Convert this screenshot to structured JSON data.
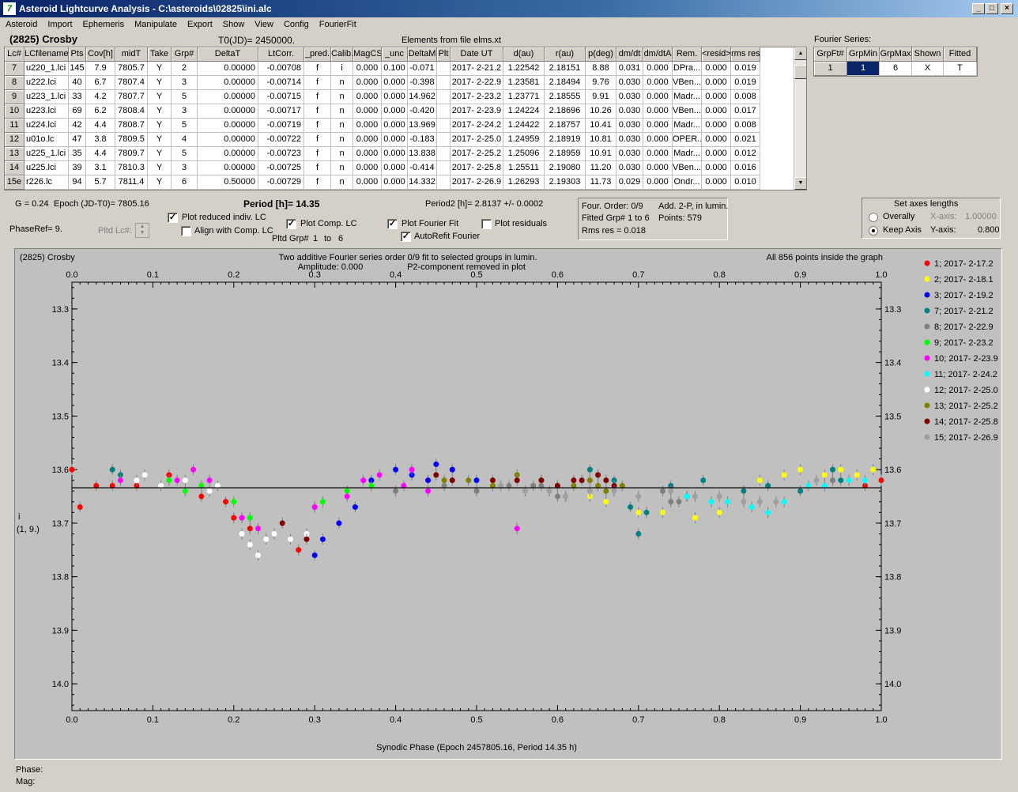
{
  "window": {
    "title": "Asteroid Lightcurve Analysis - C:\\asteroids\\02825\\ini.alc",
    "icon": "app-icon"
  },
  "menu": [
    "Asteroid",
    "Import",
    "Ephemeris",
    "Manipulate",
    "Export",
    "Show",
    "View",
    "Config",
    "FourierFit"
  ],
  "info": {
    "asteroid": "(2825) Crosby",
    "t0": "T0(JD)= 2450000.",
    "elements": "Elements from file elms.xt"
  },
  "table": {
    "headers": [
      "Lc#",
      "LCfilename",
      "Pts",
      "Cov[h]",
      "midT",
      "Take",
      "Grp#",
      "DeltaT",
      "LtCorr.",
      "_pred.",
      "Calib.",
      "MagCS",
      "_unc",
      "DeltaM",
      "Plt",
      "Date UT",
      "d(au)",
      "r(au)",
      "p(deg)",
      "dm/dt",
      "dm/dtA",
      "Rem.",
      "<resid>",
      "rms res"
    ],
    "rows": [
      [
        "7",
        "u220_1.lci",
        "145",
        "7.9",
        "7805.7",
        "Y",
        "2",
        "0.00000",
        "-0.00708",
        "f",
        "i",
        "0.000",
        "0.100",
        "-0.071",
        "",
        "2017- 2-21.2",
        "1.22542",
        "2.18151",
        "8.88",
        "0.031",
        "0.000",
        "DPra...",
        "0.000",
        "0.019"
      ],
      [
        "8",
        "u222.lci",
        "40",
        "6.7",
        "7807.4",
        "Y",
        "3",
        "0.00000",
        "-0.00714",
        "f",
        "n",
        "0.000",
        "0.000",
        "-0.398",
        "",
        "2017- 2-22.9",
        "1.23581",
        "2.18494",
        "9.76",
        "0.030",
        "0.000",
        "VBen...",
        "0.000",
        "0.019"
      ],
      [
        "9",
        "u223_1.lci",
        "33",
        "4.2",
        "7807.7",
        "Y",
        "5",
        "0.00000",
        "-0.00715",
        "f",
        "n",
        "0.000",
        "0.000",
        "14.962",
        "",
        "2017- 2-23.2",
        "1.23771",
        "2.18555",
        "9.91",
        "0.030",
        "0.000",
        "Madr...",
        "0.000",
        "0.008"
      ],
      [
        "10",
        "u223.lci",
        "69",
        "6.2",
        "7808.4",
        "Y",
        "3",
        "0.00000",
        "-0.00717",
        "f",
        "n",
        "0.000",
        "0.000",
        "-0.420",
        "",
        "2017- 2-23.9",
        "1.24224",
        "2.18696",
        "10.26",
        "0.030",
        "0.000",
        "VBen...",
        "0.000",
        "0.017"
      ],
      [
        "11",
        "u224.lci",
        "42",
        "4.4",
        "7808.7",
        "Y",
        "5",
        "0.00000",
        "-0.00719",
        "f",
        "n",
        "0.000",
        "0.000",
        "13.969",
        "",
        "2017- 2-24.2",
        "1.24422",
        "2.18757",
        "10.41",
        "0.030",
        "0.000",
        "Madr...",
        "0.000",
        "0.008"
      ],
      [
        "12",
        "u01o.lc",
        "47",
        "3.8",
        "7809.5",
        "Y",
        "4",
        "0.00000",
        "-0.00722",
        "f",
        "n",
        "0.000",
        "0.000",
        "-0.183",
        "",
        "2017- 2-25.0",
        "1.24959",
        "2.18919",
        "10.81",
        "0.030",
        "0.000",
        "OPER...",
        "0.000",
        "0.021"
      ],
      [
        "13",
        "u225_1.lci",
        "35",
        "4.4",
        "7809.7",
        "Y",
        "5",
        "0.00000",
        "-0.00723",
        "f",
        "n",
        "0.000",
        "0.000",
        "13.838",
        "",
        "2017- 2-25.2",
        "1.25096",
        "2.18959",
        "10.91",
        "0.030",
        "0.000",
        "Madr...",
        "0.000",
        "0.012"
      ],
      [
        "14",
        "u225.lci",
        "39",
        "3.1",
        "7810.3",
        "Y",
        "3",
        "0.00000",
        "-0.00725",
        "f",
        "n",
        "0.000",
        "0.000",
        "-0.414",
        "",
        "2017- 2-25.8",
        "1.25511",
        "2.19080",
        "11.20",
        "0.030",
        "0.000",
        "VBen...",
        "0.000",
        "0.016"
      ],
      [
        "15e",
        "r226.lc",
        "94",
        "5.7",
        "7811.4",
        "Y",
        "6",
        "0.50000",
        "-0.00729",
        "f",
        "n",
        "0.000",
        "0.000",
        "14.332",
        "",
        "2017- 2-26.9",
        "1.26293",
        "2.19303",
        "11.73",
        "0.029",
        "0.000",
        "Ondr...",
        "0.000",
        "0.010"
      ]
    ]
  },
  "fourier": {
    "label": "Fourier Series:",
    "headers": [
      "GrpFt#",
      "GrpMin",
      "GrpMax",
      "Shown",
      "Fitted"
    ],
    "row": [
      "1",
      "1",
      "6",
      "X",
      "T"
    ]
  },
  "params": {
    "g": "G = 0.24",
    "epoch": "Epoch (JD-T0)= 7805.16",
    "period": "Period [h]= 14.35",
    "period2": "Period2 [h]= 2.8137 +/- 0.0002",
    "phaseref": "PhaseRef= 9.",
    "pltd_lc": "Pltd Lc#:",
    "plot_reduced": "Plot reduced indiv. LC",
    "align_comp": "Align with Comp. LC",
    "plot_comp": "Plot Comp. LC",
    "pltd_grp": "Pltd Grp#",
    "grp_from": "1",
    "grp_to_label": "to",
    "grp_to": "6",
    "plot_fourier": "Plot Fourier Fit",
    "autorefit": "AutoRefit Fourier",
    "plot_resid": "Plot residuals",
    "plot_reduced_on": true,
    "align_comp_on": false,
    "plot_comp_on": true,
    "plot_fourier_on": true,
    "autorefit_on": true,
    "plot_resid_on": false
  },
  "fitinfo": {
    "order": "Four. Order:  0/9",
    "add": "Add. 2-P, in lumin.",
    "fitted": "Fitted Grp# 1 to 6",
    "points": "Points: 579",
    "rms": "Rms res     = 0.018"
  },
  "axes": {
    "title": "Set axes lengths",
    "overally": "Overally",
    "keep": "Keep Axis",
    "xaxis_label": "X-axis:",
    "xaxis_val": "1.00000",
    "yaxis_label": "Y-axis:",
    "yaxis_val": "0.800",
    "mode": "keep"
  },
  "status": {
    "phase": "Phase:",
    "mag": "Mag:"
  },
  "chart_data": {
    "type": "scatter",
    "title_left": "(2825) Crosby",
    "title": "Two additive Fourier series order 0/9 fit to selected groups in lumin.",
    "subtitle1": "Amplitude: 0.000",
    "subtitle2": "P2-component removed in plot",
    "title_right": "All 856 points inside the graph",
    "xlabel": "Synodic Phase (Epoch 2457805.16, Period 14.35 h)",
    "ylabel": "i",
    "ylabel2": "(1, 9.)",
    "xlim": [
      0,
      1
    ],
    "ylim": [
      13.25,
      14.05
    ],
    "y_inverted": true,
    "xticks": [
      "0.0",
      "0.1",
      "0.2",
      "0.3",
      "0.4",
      "0.5",
      "0.6",
      "0.7",
      "0.8",
      "0.9",
      "1.0"
    ],
    "yticks": [
      "13.3",
      "13.4",
      "13.5",
      "13.6",
      "13.7",
      "13.8",
      "13.9",
      "14.0"
    ],
    "fit_level": 13.634,
    "series": [
      {
        "name": "1; 2017- 2-17.2",
        "color": "#ff0000",
        "x": [
          0.0,
          0.01,
          0.03,
          0.05,
          0.08,
          0.12,
          0.16,
          0.19,
          0.2,
          0.22,
          0.28,
          0.98,
          1.0
        ],
        "y": [
          13.6,
          13.67,
          13.63,
          13.63,
          13.63,
          13.61,
          13.65,
          13.66,
          13.69,
          13.71,
          13.75,
          13.63,
          13.62
        ]
      },
      {
        "name": "2; 2017- 2-18.1",
        "color": "#ffff00",
        "x": [
          0.64,
          0.66,
          0.7,
          0.73,
          0.77,
          0.8,
          0.83,
          0.85,
          0.88,
          0.9,
          0.93,
          0.95,
          0.97,
          0.99
        ],
        "y": [
          13.65,
          13.66,
          13.68,
          13.68,
          13.69,
          13.68,
          13.64,
          13.62,
          13.61,
          13.6,
          13.61,
          13.6,
          13.61,
          13.6
        ]
      },
      {
        "name": "3; 2017- 2-19.2",
        "color": "#0000ff",
        "x": [
          0.3,
          0.31,
          0.33,
          0.35,
          0.37,
          0.4,
          0.42,
          0.44,
          0.45,
          0.47,
          0.5
        ],
        "y": [
          13.76,
          13.73,
          13.7,
          13.67,
          13.62,
          13.6,
          13.61,
          13.62,
          13.59,
          13.6,
          13.62
        ]
      },
      {
        "name": "7; 2017- 2-21.2",
        "color": "#008080",
        "x": [
          0.05,
          0.06,
          0.64,
          0.65,
          0.67,
          0.69,
          0.7,
          0.71,
          0.74,
          0.76,
          0.78,
          0.83,
          0.86,
          0.9,
          0.94,
          0.95
        ],
        "y": [
          13.6,
          13.61,
          13.6,
          13.61,
          13.62,
          13.67,
          13.72,
          13.68,
          13.63,
          13.65,
          13.62,
          13.64,
          13.63,
          13.64,
          13.6,
          13.62
        ]
      },
      {
        "name": "8; 2017- 2-22.9",
        "color": "#808080",
        "x": [
          0.3,
          0.4,
          0.46,
          0.5,
          0.54,
          0.57,
          0.58,
          0.6,
          0.61,
          0.73,
          0.74,
          0.75,
          0.94
        ],
        "y": [
          13.67,
          13.64,
          13.63,
          13.64,
          13.63,
          13.63,
          13.63,
          13.65,
          13.65,
          13.64,
          13.66,
          13.66,
          13.62
        ]
      },
      {
        "name": "9; 2017- 2-23.2",
        "color": "#00ff00",
        "x": [
          0.12,
          0.14,
          0.16,
          0.2,
          0.22,
          0.31,
          0.34,
          0.37
        ],
        "y": [
          13.62,
          13.64,
          13.63,
          13.66,
          13.69,
          13.66,
          13.64,
          13.63
        ]
      },
      {
        "name": "10; 2017- 2-23.9",
        "color": "#ff00ff",
        "x": [
          0.06,
          0.13,
          0.15,
          0.17,
          0.21,
          0.23,
          0.3,
          0.34,
          0.36,
          0.38,
          0.41,
          0.42,
          0.44,
          0.55
        ],
        "y": [
          13.62,
          13.62,
          13.6,
          13.62,
          13.69,
          13.71,
          13.67,
          13.65,
          13.62,
          13.61,
          13.63,
          13.6,
          13.64,
          13.71
        ]
      },
      {
        "name": "11; 2017- 2-24.2",
        "color": "#00ffff",
        "x": [
          0.76,
          0.79,
          0.81,
          0.84,
          0.86,
          0.88,
          0.91,
          0.93,
          0.96,
          0.98
        ],
        "y": [
          13.65,
          13.66,
          13.66,
          13.67,
          13.68,
          13.66,
          13.63,
          13.63,
          13.62,
          13.62
        ]
      },
      {
        "name": "12; 2017- 2-25.0",
        "color": "#ffffff",
        "x": [
          0.08,
          0.09,
          0.11,
          0.14,
          0.17,
          0.18,
          0.21,
          0.22,
          0.23,
          0.24,
          0.25,
          0.27,
          0.29
        ],
        "y": [
          13.62,
          13.61,
          13.63,
          13.62,
          13.64,
          13.63,
          13.72,
          13.74,
          13.76,
          13.73,
          13.72,
          13.73,
          13.72
        ]
      },
      {
        "name": "13; 2017- 2-25.2",
        "color": "#808000",
        "x": [
          0.46,
          0.49,
          0.52,
          0.55,
          0.58,
          0.6,
          0.62,
          0.64,
          0.65,
          0.66,
          0.68
        ],
        "y": [
          13.62,
          13.62,
          13.63,
          13.61,
          13.62,
          13.63,
          13.63,
          13.62,
          13.63,
          13.64,
          13.63
        ]
      },
      {
        "name": "14; 2017- 2-25.8",
        "color": "#800000",
        "x": [
          0.26,
          0.29,
          0.45,
          0.47,
          0.52,
          0.55,
          0.58,
          0.6,
          0.62,
          0.63,
          0.65,
          0.66,
          0.67
        ],
        "y": [
          13.7,
          13.73,
          13.61,
          13.62,
          13.62,
          13.62,
          13.62,
          13.63,
          13.62,
          13.62,
          13.61,
          13.62,
          13.63
        ]
      },
      {
        "name": "15; 2017- 2-26.9",
        "color": "#a0a0a0",
        "x": [
          0.53,
          0.56,
          0.59,
          0.61,
          0.64,
          0.67,
          0.7,
          0.74,
          0.77,
          0.8,
          0.83,
          0.85,
          0.87,
          0.92
        ],
        "y": [
          13.63,
          13.64,
          13.64,
          13.65,
          13.64,
          13.64,
          13.65,
          13.64,
          13.65,
          13.65,
          13.66,
          13.66,
          13.66,
          13.62
        ]
      }
    ]
  }
}
